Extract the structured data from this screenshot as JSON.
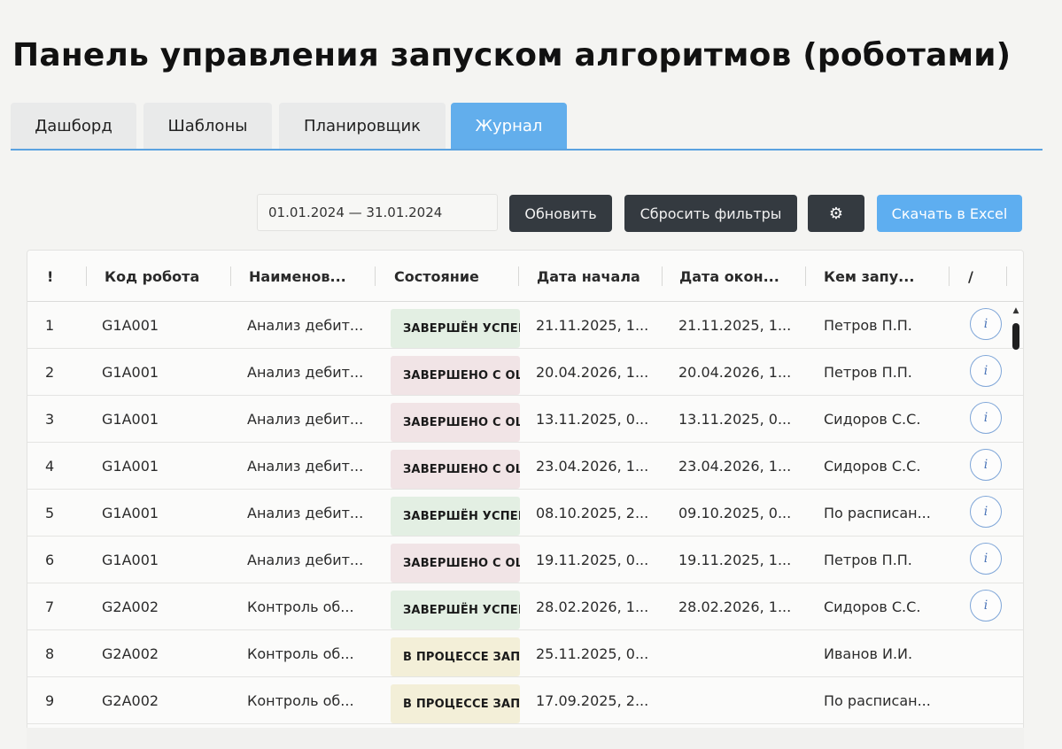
{
  "page": {
    "title": "Панель управления запуском алгоритмов (роботами)"
  },
  "tabs": [
    {
      "label": "Дашборд",
      "active": false
    },
    {
      "label": "Шаблоны",
      "active": false
    },
    {
      "label": "Планировщик",
      "active": false
    },
    {
      "label": "Журнал",
      "active": true
    }
  ],
  "toolbar": {
    "date_range": "01.01.2024 — 31.01.2024",
    "refresh_label": "Обновить",
    "reset_filters_label": "Сбросить фильтры",
    "settings_icon": "gear-icon",
    "export_label": "Скачать в Excel"
  },
  "table": {
    "columns": {
      "num": "!",
      "code": "Код робота",
      "name": "Наименов...",
      "status": "Состояние",
      "start": "Дата начала",
      "end": "Дата окон...",
      "by": "Кем запу...",
      "actions": "/"
    },
    "rows": [
      {
        "num": "1",
        "code": "G1A001",
        "name": "Анализ дебит...",
        "status": "ЗАВЕРШЁН УСПЕШ",
        "status_kind": "success",
        "start": "21.11.2025, 1...",
        "end": "21.11.2025, 1...",
        "by": "Петров П.П."
      },
      {
        "num": "2",
        "code": "G1A001",
        "name": "Анализ дебит...",
        "status": "ЗАВЕРШЕНО С ОШ",
        "status_kind": "error",
        "start": "20.04.2026, 1...",
        "end": "20.04.2026, 1...",
        "by": "Петров П.П."
      },
      {
        "num": "3",
        "code": "G1A001",
        "name": "Анализ дебит...",
        "status": "ЗАВЕРШЕНО С ОШ",
        "status_kind": "error",
        "start": "13.11.2025, 0...",
        "end": "13.11.2025, 0...",
        "by": "Сидоров С.С."
      },
      {
        "num": "4",
        "code": "G1A001",
        "name": "Анализ дебит...",
        "status": "ЗАВЕРШЕНО С ОШ",
        "status_kind": "error",
        "start": "23.04.2026, 1...",
        "end": "23.04.2026, 1...",
        "by": "Сидоров С.С."
      },
      {
        "num": "5",
        "code": "G1A001",
        "name": "Анализ дебит...",
        "status": "ЗАВЕРШЁН УСПЕШ",
        "status_kind": "success",
        "start": "08.10.2025, 2...",
        "end": "09.10.2025, 0...",
        "by": "По расписан..."
      },
      {
        "num": "6",
        "code": "G1A001",
        "name": "Анализ дебит...",
        "status": "ЗАВЕРШЕНО С ОШ",
        "status_kind": "error",
        "start": "19.11.2025, 0...",
        "end": "19.11.2025, 1...",
        "by": "Петров П.П."
      },
      {
        "num": "7",
        "code": "G2A002",
        "name": "Контроль об...",
        "status": "ЗАВЕРШЁН УСПЕШ",
        "status_kind": "success",
        "start": "28.02.2026, 1...",
        "end": "28.02.2026, 1...",
        "by": "Сидоров С.С."
      },
      {
        "num": "8",
        "code": "G2A002",
        "name": "Контроль об...",
        "status": "В ПРОЦЕССЕ ЗАП",
        "status_kind": "progress",
        "start": "25.11.2025, 0...",
        "end": "",
        "by": "Иванов И.И."
      },
      {
        "num": "9",
        "code": "G2A002",
        "name": "Контроль об...",
        "status": "В ПРОЦЕССЕ ЗАП",
        "status_kind": "progress",
        "start": "17.09.2025, 2...",
        "end": "",
        "by": "По расписан..."
      }
    ],
    "info_icon_label": "i"
  },
  "colors": {
    "accent": "#5eaef0",
    "dark_button": "#343a40",
    "status_success_bg": "#e3efe3",
    "status_error_bg": "#f1e4e6",
    "status_progress_bg": "#f3efd8"
  }
}
